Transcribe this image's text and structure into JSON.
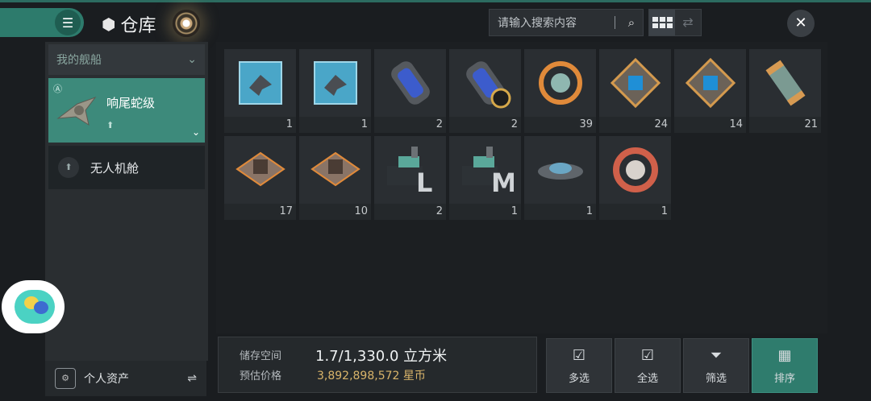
{
  "header": {
    "title": "仓库",
    "search_placeholder": "请输入搜索内容"
  },
  "sidebar": {
    "section_label": "我的舰船",
    "ship_name": "响尾蛇级",
    "drone_label": "无人机舱",
    "assets_label": "个人资产"
  },
  "items": [
    {
      "count": "1",
      "icon": "escort-ship-card-icon",
      "color": "#4aa6c8"
    },
    {
      "count": "1",
      "icon": "fighter-ship-card-icon",
      "color": "#4aa6c8"
    },
    {
      "count": "2",
      "icon": "blue-module-capsule-icon",
      "color": "#3c5ccc"
    },
    {
      "count": "2",
      "icon": "blue-module-capsule-locked-icon",
      "color": "#3c5ccc"
    },
    {
      "count": "39",
      "icon": "orange-ring-core-icon",
      "color": "#e08a3a"
    },
    {
      "count": "24",
      "icon": "blue-chip-plate-icon",
      "color": "#d49a4e"
    },
    {
      "count": "14",
      "icon": "blue-chip-plate-icon",
      "color": "#d49a4e"
    },
    {
      "count": "21",
      "icon": "green-cylinder-icon",
      "color": "#d79a52"
    },
    {
      "count": "17",
      "icon": "station-blueprint-icon",
      "color": "#e08a3a"
    },
    {
      "count": "10",
      "icon": "station-blueprint-icon",
      "color": "#e08a3a"
    },
    {
      "count": "2",
      "icon": "factory-L-blueprint-icon",
      "color": "#5aa89a",
      "letter": "L"
    },
    {
      "count": "1",
      "icon": "factory-M-blueprint-icon",
      "color": "#5aa89a",
      "letter": "M"
    },
    {
      "count": "1",
      "icon": "disc-drone-icon",
      "color": "#6aa6c4"
    },
    {
      "count": "1",
      "icon": "red-ring-module-icon",
      "color": "#d0604a"
    }
  ],
  "storage": {
    "space_label": "储存空间",
    "space_value": "1.7/1,330.0 立方米",
    "price_label": "预估价格",
    "price_value": "3,892,898,572 星币"
  },
  "actions": {
    "multi_select": "多选",
    "select_all": "全选",
    "filter": "筛选",
    "sort": "排序"
  }
}
